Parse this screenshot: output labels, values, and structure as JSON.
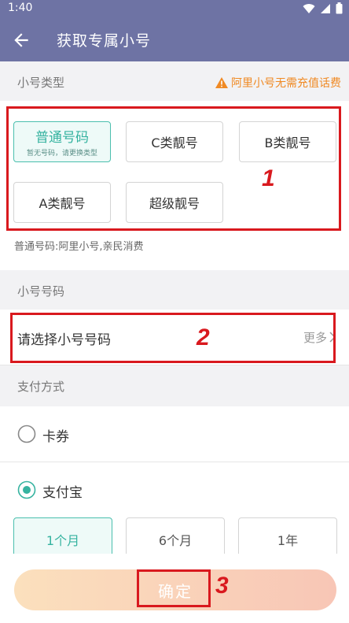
{
  "status_bar": {
    "time": "1:40"
  },
  "header": {
    "title": "获取专属小号"
  },
  "type_section": {
    "label": "小号类型",
    "warning": "阿里小号无需充值话费",
    "chips": [
      {
        "label": "普通号码",
        "sub": "暂无号码，请更换类型",
        "selected": true
      },
      {
        "label": "C类靓号",
        "sub": ""
      },
      {
        "label": "B类靓号",
        "sub": ""
      },
      {
        "label": "A类靓号",
        "sub": ""
      },
      {
        "label": "超级靓号",
        "sub": ""
      }
    ],
    "hint": "普通号码:阿里小号,亲民消费"
  },
  "number_section": {
    "label": "小号号码",
    "select_label": "请选择小号号码",
    "more": "更多"
  },
  "payment_section": {
    "label": "支付方式",
    "options": [
      {
        "label": "卡券",
        "checked": false
      },
      {
        "label": "支付宝",
        "checked": true
      }
    ],
    "periods": [
      {
        "label": "1个月",
        "selected": true
      },
      {
        "label": "6个月"
      },
      {
        "label": "1年"
      }
    ]
  },
  "confirm_label": "确定",
  "annotations": [
    "1",
    "2",
    "3"
  ],
  "colors": {
    "header": "#6e73a4",
    "accent": "#36b3a0",
    "warning": "#f08a24",
    "annotation": "#d9191e"
  }
}
